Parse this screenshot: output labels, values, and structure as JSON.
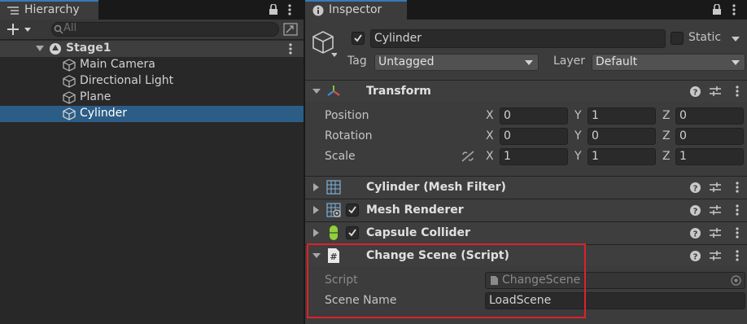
{
  "hierarchy": {
    "tab_label": "Hierarchy",
    "search_placeholder": "All",
    "scene": "Stage1",
    "items": [
      "Main Camera",
      "Directional Light",
      "Plane",
      "Cylinder"
    ]
  },
  "inspector": {
    "tab_label": "Inspector",
    "object_name": "Cylinder",
    "static_label": "Static",
    "tag_label": "Tag",
    "tag_value": "Untagged",
    "layer_label": "Layer",
    "layer_value": "Default",
    "transform": {
      "title": "Transform",
      "position_label": "Position",
      "rotation_label": "Rotation",
      "scale_label": "Scale",
      "x": "X",
      "y": "Y",
      "z": "Z",
      "position": [
        "0",
        "1",
        "0"
      ],
      "rotation": [
        "0",
        "0",
        "0"
      ],
      "scale": [
        "1",
        "1",
        "1"
      ]
    },
    "components": [
      "Cylinder (Mesh Filter)",
      "Mesh Renderer",
      "Capsule Collider"
    ],
    "script_component": {
      "title": "Change Scene (Script)",
      "script_label": "Script",
      "script_value": "ChangeScene",
      "scene_name_label": "Scene Name",
      "scene_name_value": "LoadScene"
    }
  },
  "colors": {
    "selection": "#2c5d87",
    "highlight_box": "#e0202a",
    "tab_accent": "#3a79bb"
  }
}
